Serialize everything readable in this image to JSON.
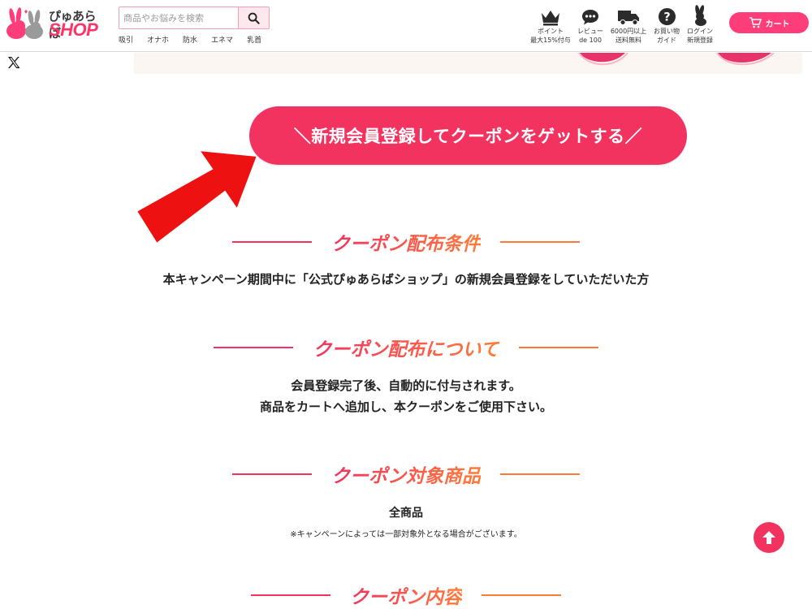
{
  "header": {
    "logo_top": "ぴゅあらば",
    "logo_shop": "SHOP",
    "search": {
      "placeholder": "商品やお悩みを検索"
    },
    "quick_links": [
      "吸引",
      "オナホ",
      "防水",
      "エネマ",
      "乳首"
    ],
    "icons": [
      {
        "icon": "crown-icon",
        "line1": "ポイント",
        "line2": "最大15%付与"
      },
      {
        "icon": "chat-bubble-icon",
        "line1": "レビュー",
        "line2": "de 100"
      },
      {
        "icon": "truck-icon",
        "line1": "6000円以上",
        "line2": "送料無料"
      },
      {
        "icon": "question-icon",
        "line1": "お買い物",
        "line2": "ガイド"
      },
      {
        "icon": "rabbit-icon",
        "line1": "ログイン",
        "line2": "新規登録"
      }
    ],
    "cart_label": "カート"
  },
  "cta": {
    "label": "＼新規会員登録してクーポンをゲットする／"
  },
  "sections": [
    {
      "title": "クーポン配布条件",
      "lines": [
        "本キャンペーン期間中に「公式ぴゅあらばショップ」の新規会員登録をしていただいた方"
      ]
    },
    {
      "title": "クーポン配布について",
      "lines": [
        "会員登録完了後、自動的に付与されます。",
        "商品をカートへ追加し、本クーポンをご使用下さい。"
      ]
    },
    {
      "title": "クーポン対象商品",
      "lines": [
        "全商品"
      ],
      "note": "※キャンペーンによっては一部対象外となる場合がございます。"
    },
    {
      "title": "クーポン内容"
    }
  ],
  "colors": {
    "accent": "#f2335f",
    "accent_orange": "#ff7a3a",
    "cart": "#ff3d7a"
  }
}
